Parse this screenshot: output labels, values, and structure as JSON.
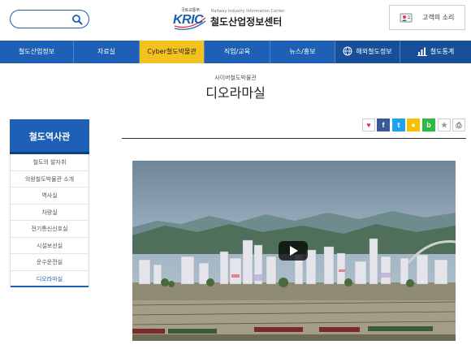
{
  "header": {
    "search": {
      "placeholder": "",
      "value": "",
      "icon": "search-icon"
    },
    "logo": {
      "ministry_text": "국토교통부",
      "brand_text": "KRIC",
      "english_text": "Railway Industry Information Center",
      "korean_name": "철도산업정보센터"
    },
    "customer_button": {
      "label": "고객의 소리",
      "icon": "customer-voice-icon"
    }
  },
  "nav": {
    "items": [
      {
        "label": "철도산업정보",
        "icon": ""
      },
      {
        "label": "자료실",
        "icon": ""
      },
      {
        "label": "Cyber철도박물관",
        "icon": ""
      },
      {
        "label": "직업/교육",
        "icon": ""
      },
      {
        "label": "뉴스/홍보",
        "icon": ""
      },
      {
        "label": "해외철도정보",
        "icon": "globe-icon"
      },
      {
        "label": "철도통계",
        "icon": "bar-chart-icon"
      }
    ],
    "active_index": 2
  },
  "page": {
    "subtitle": "사이버철도박물관",
    "title": "디오라마실"
  },
  "sidebar": {
    "heading": "철도역사관",
    "items": [
      {
        "label": "철도의 발자취"
      },
      {
        "label": "의왕철도박물관 소개"
      },
      {
        "label": "역사실"
      },
      {
        "label": "차량실"
      },
      {
        "label": "전기통신신호실"
      },
      {
        "label": "시설보선실"
      },
      {
        "label": "운수운전실"
      },
      {
        "label": "디오라마실"
      }
    ],
    "active_index": 7
  },
  "share": {
    "buttons": [
      {
        "name": "like-icon",
        "glyph": "♥",
        "color": "#e8334a"
      },
      {
        "name": "facebook-icon",
        "glyph": "f",
        "color": "#3b5998"
      },
      {
        "name": "twitter-icon",
        "glyph": "t",
        "color": "#1da1f2"
      },
      {
        "name": "kakaostory-icon",
        "glyph": "●",
        "color": "#f6c200"
      },
      {
        "name": "band-icon",
        "glyph": "b",
        "color": "#2bba45"
      },
      {
        "name": "bookmark-icon",
        "glyph": "★",
        "color": "#999999"
      },
      {
        "name": "print-icon",
        "glyph": "⎙",
        "color": "#777777"
      }
    ]
  },
  "video": {
    "icon": "play-icon"
  },
  "colors": {
    "primary": "#1d60b5",
    "active_nav": "#f4c21f",
    "sidebar_dark": "#0f3f80"
  }
}
